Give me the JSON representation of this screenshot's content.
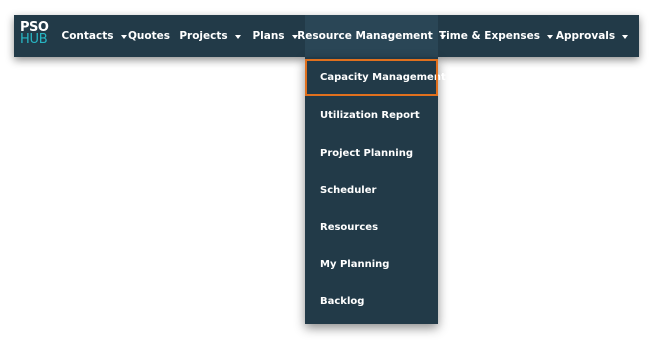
{
  "logo": {
    "line1": "PSO",
    "line2": "HUB"
  },
  "nav": {
    "contacts": "Contacts",
    "quotes": "Quotes",
    "projects": "Projects",
    "plans": "Plans",
    "resource_management": "Resource Management",
    "time_expenses": "Time & Expenses",
    "approvals": "Approvals"
  },
  "dropdown": {
    "items": [
      "Capacity Management",
      "Utilization Report",
      "Project Planning",
      "Scheduler",
      "Resources",
      "My Planning",
      "Backlog"
    ],
    "highlighted": "Capacity Management"
  },
  "colors": {
    "nav_bg": "#223a48",
    "logo_accent": "#27b6c4",
    "highlight_border": "#e0701e"
  },
  "icons": {
    "dropdown_caret": "caret-down-icon"
  }
}
